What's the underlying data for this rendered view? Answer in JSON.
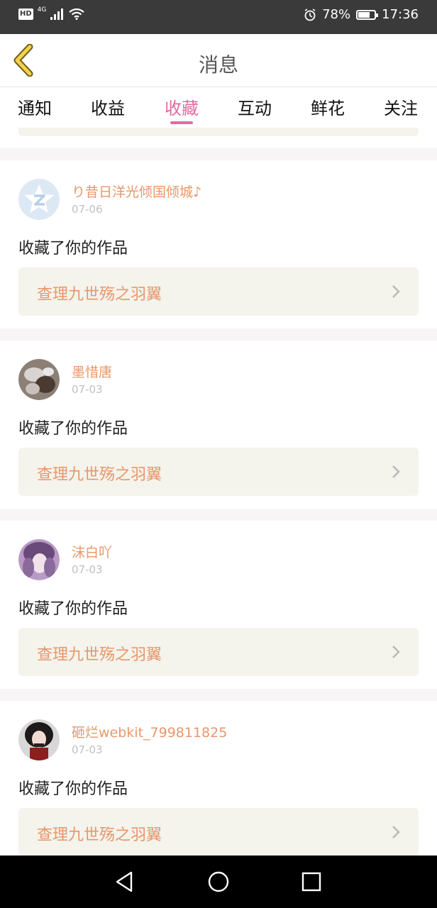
{
  "status_bar": {
    "hd": "HD",
    "network": "4G",
    "battery_percent": "78%",
    "battery_level": 0.78,
    "time": "17:36"
  },
  "header": {
    "title": "消息",
    "back_icon": "chevron-left-icon"
  },
  "tabs": [
    {
      "label": "通知"
    },
    {
      "label": "收益"
    },
    {
      "label": "收藏",
      "active": true
    },
    {
      "label": "互动"
    },
    {
      "label": "鲜花"
    },
    {
      "label": "关注"
    }
  ],
  "notifications": [
    {
      "user": "り昔日洋光倾国倾城♪",
      "date": "07-06",
      "action": "收藏了你的作品",
      "work": "查理九世殇之羽翼",
      "avatar": "default-avatar"
    },
    {
      "user": "墨惜唐",
      "date": "07-03",
      "action": "收藏了你的作品",
      "work": "查理九世殇之羽翼",
      "avatar": "user-avatar"
    },
    {
      "user": "沫白吖",
      "date": "07-03",
      "action": "收藏了你的作品",
      "work": "查理九世殇之羽翼",
      "avatar": "user-avatar"
    },
    {
      "user": "砸烂webkit_799811825",
      "date": "07-03",
      "action": "收藏了你的作品",
      "work": "查理九世殇之羽翼",
      "avatar": "user-avatar"
    }
  ],
  "colors": {
    "accent_pink": "#e36aa0",
    "accent_orange": "#e8976a",
    "card_bg": "#f4f3ec"
  }
}
